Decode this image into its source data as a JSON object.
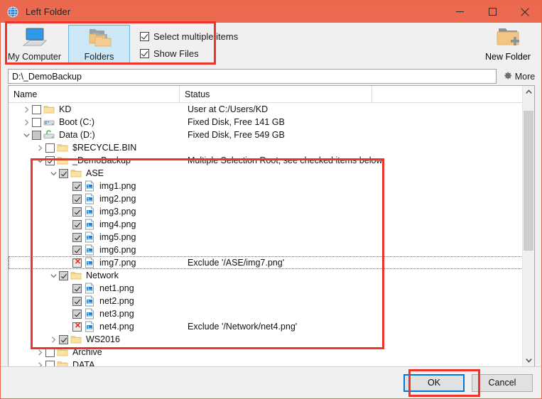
{
  "window": {
    "title": "Left Folder",
    "app_icon": "globe-icon",
    "minimize": "─",
    "maximize": "□",
    "close": "✕",
    "accent_color": "#eb6a4f",
    "annotation_color": "#f0322b"
  },
  "toolbar": {
    "my_computer_label": "My Computer",
    "folders_label": "Folders",
    "new_folder_label": "New Folder",
    "checkboxes": [
      {
        "label": "Select multiple items",
        "checked": true
      },
      {
        "label": "Show Files",
        "checked": true
      }
    ]
  },
  "path": {
    "value": "D:\\_DemoBackup",
    "more_label": "More",
    "more_icon": "gear-icon"
  },
  "columns": [
    "Name",
    "Status"
  ],
  "tree": [
    {
      "indent": 0,
      "twisty": "right",
      "check": "unchecked",
      "icon": "folder",
      "name": "KD",
      "status": "User at C:/Users/KD"
    },
    {
      "indent": 0,
      "twisty": "right",
      "check": "unchecked",
      "icon": "drive",
      "name": "Boot (C:)",
      "status": "Fixed Disk, Free 141 GB"
    },
    {
      "indent": 0,
      "twisty": "down",
      "check": "indet",
      "icon": "drive2",
      "name": "Data (D:)",
      "status": "Fixed Disk, Free 549 GB"
    },
    {
      "indent": 1,
      "twisty": "right",
      "check": "unchecked",
      "icon": "folder",
      "name": "$RECYCLE.BIN",
      "status": ""
    },
    {
      "indent": 1,
      "twisty": "down",
      "check": "checked",
      "icon": "folder",
      "name": "_DemoBackup",
      "status": "Multiple Selection Root, see checked items below"
    },
    {
      "indent": 2,
      "twisty": "down",
      "check": "shaded",
      "icon": "folder",
      "name": "ASE",
      "status": ""
    },
    {
      "indent": 3,
      "twisty": "none",
      "check": "shaded",
      "icon": "image",
      "name": "img1.png",
      "status": ""
    },
    {
      "indent": 3,
      "twisty": "none",
      "check": "shaded",
      "icon": "image",
      "name": "img2.png",
      "status": ""
    },
    {
      "indent": 3,
      "twisty": "none",
      "check": "shaded",
      "icon": "image",
      "name": "img3.png",
      "status": ""
    },
    {
      "indent": 3,
      "twisty": "none",
      "check": "shaded",
      "icon": "image",
      "name": "img4.png",
      "status": ""
    },
    {
      "indent": 3,
      "twisty": "none",
      "check": "shaded",
      "icon": "image",
      "name": "img5.png",
      "status": ""
    },
    {
      "indent": 3,
      "twisty": "none",
      "check": "shaded",
      "icon": "image",
      "name": "img6.png",
      "status": ""
    },
    {
      "indent": 3,
      "twisty": "none",
      "check": "exclude",
      "icon": "image",
      "name": "img7.png",
      "status": "Exclude '/ASE/img7.png'",
      "focused": true
    },
    {
      "indent": 2,
      "twisty": "down",
      "check": "shaded",
      "icon": "folder",
      "name": "Network",
      "status": ""
    },
    {
      "indent": 3,
      "twisty": "none",
      "check": "shaded",
      "icon": "image",
      "name": "net1.png",
      "status": ""
    },
    {
      "indent": 3,
      "twisty": "none",
      "check": "shaded",
      "icon": "image",
      "name": "net2.png",
      "status": ""
    },
    {
      "indent": 3,
      "twisty": "none",
      "check": "shaded",
      "icon": "image",
      "name": "net3.png",
      "status": ""
    },
    {
      "indent": 3,
      "twisty": "none",
      "check": "exclude",
      "icon": "image",
      "name": "net4.png",
      "status": "Exclude '/Network/net4.png'"
    },
    {
      "indent": 2,
      "twisty": "right",
      "check": "shaded",
      "icon": "folder",
      "name": "WS2016",
      "status": ""
    },
    {
      "indent": 1,
      "twisty": "right",
      "check": "unchecked",
      "icon": "folder",
      "name": "Archive",
      "status": ""
    },
    {
      "indent": 1,
      "twisty": "right",
      "check": "unchecked",
      "icon": "folder",
      "name": "DATA",
      "status": ""
    }
  ],
  "footer": {
    "ok_label": "OK",
    "cancel_label": "Cancel"
  }
}
